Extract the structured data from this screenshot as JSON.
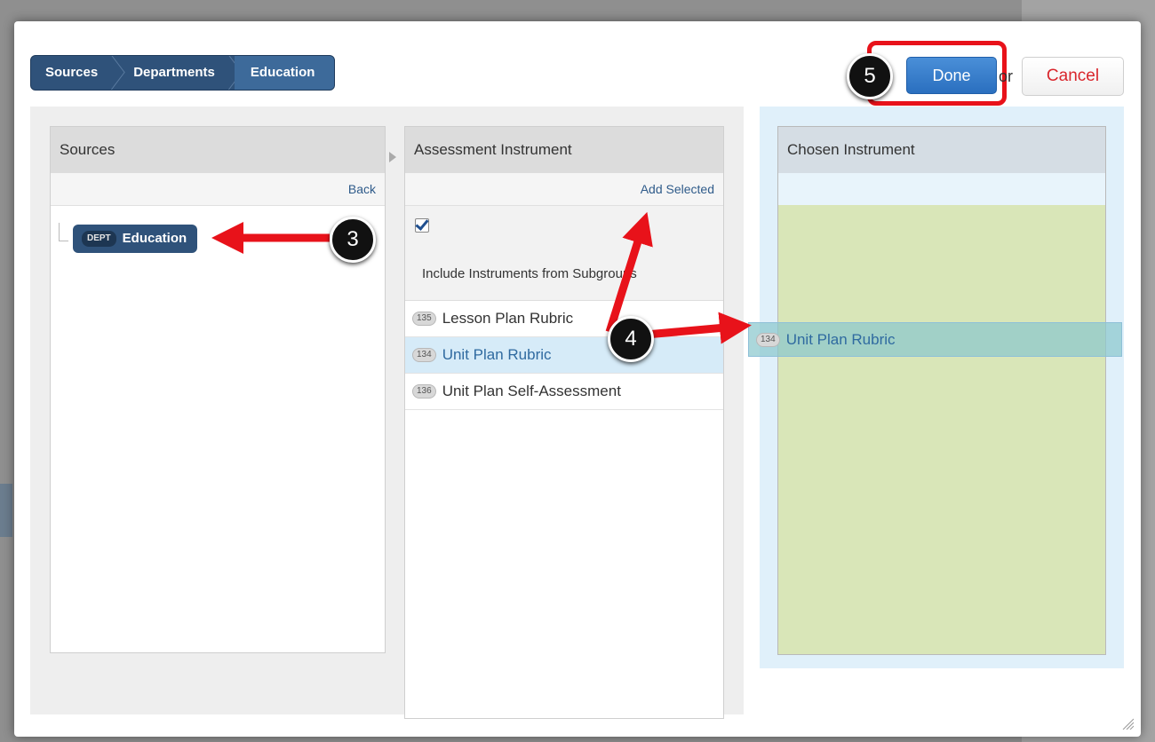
{
  "breadcrumb": [
    "Sources",
    "Departments",
    "Education"
  ],
  "actions": {
    "done": "Done",
    "or": "or",
    "cancel": "Cancel"
  },
  "sources_panel": {
    "header": "Sources",
    "back": "Back",
    "node": {
      "tag": "DEPT",
      "label": "Education"
    }
  },
  "instrument_panel": {
    "header": "Assessment Instrument",
    "add_selected": "Add Selected",
    "include_checked": true,
    "include_label": "Include Instruments from Subgroups",
    "items": [
      {
        "id": "135",
        "label": "Lesson Plan Rubric",
        "selected": false
      },
      {
        "id": "134",
        "label": "Unit Plan Rubric",
        "selected": true
      },
      {
        "id": "136",
        "label": "Unit Plan Self-Assessment",
        "selected": false
      }
    ]
  },
  "chosen_panel": {
    "header": "Chosen Instrument",
    "dragging": {
      "id": "134",
      "label": "Unit Plan Rubric"
    }
  },
  "steps": [
    "3",
    "4",
    "5"
  ],
  "colors": {
    "annotation_red": "#e8121a",
    "navy": "#2f527a",
    "chosen_bg": "#d9e6b8"
  }
}
